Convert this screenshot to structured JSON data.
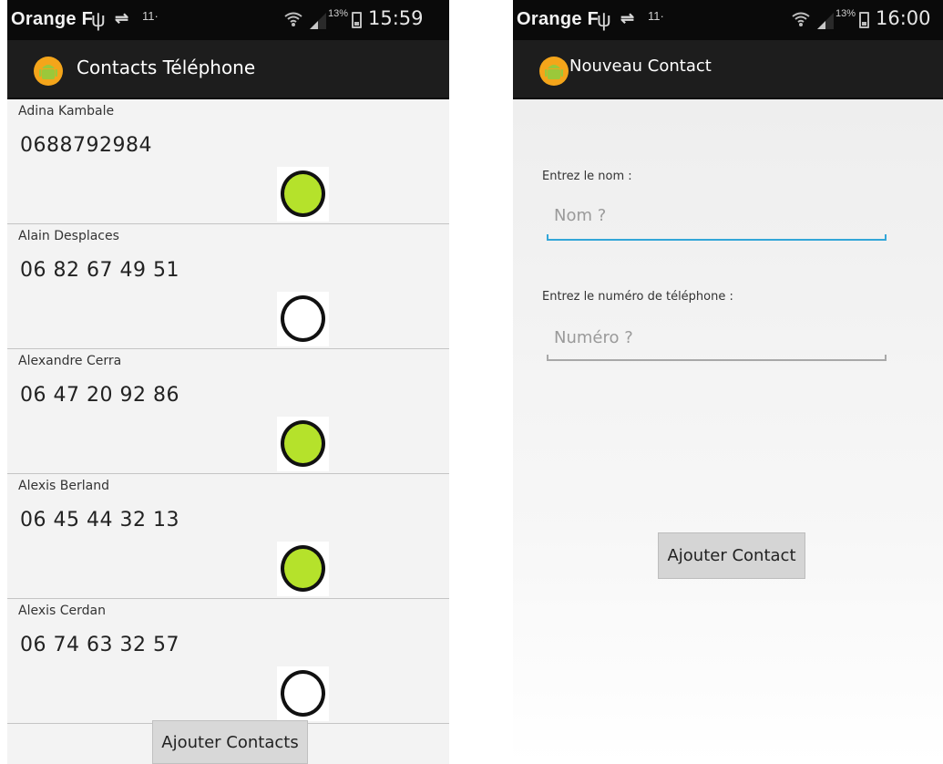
{
  "colors": {
    "active_green": "#b5e22b",
    "inactive_white": "#ffffff",
    "action_bar": "#1d1d1d",
    "focus_blue": "#33a6d8"
  },
  "icons": {
    "app": "android-icon",
    "usb": "usb-icon",
    "sync": "sync-icon",
    "wifi": "wifi-icon",
    "signal": "signal-icon",
    "battery": "battery-icon"
  },
  "left": {
    "status": {
      "carrier": "Orange F",
      "usb": "ψ",
      "sync": "⇌",
      "notif": "11·",
      "battery_pct": "13%",
      "time": "15:59"
    },
    "title": "Contacts Téléphone",
    "contacts": [
      {
        "name": "Adina Kambale",
        "phone": "0688792984",
        "active": true
      },
      {
        "name": "Alain Desplaces",
        "phone": "06 82 67 49 51",
        "active": false
      },
      {
        "name": "Alexandre Cerra",
        "phone": "06 47 20 92 86",
        "active": true
      },
      {
        "name": "Alexis Berland",
        "phone": "06 45 44 32 13",
        "active": true
      },
      {
        "name": "Alexis Cerdan",
        "phone": "06 74 63 32 57",
        "active": false
      }
    ],
    "button": "Ajouter Contacts"
  },
  "right": {
    "status": {
      "carrier": "Orange F",
      "usb": "ψ",
      "sync": "⇌",
      "notif": "11·",
      "battery_pct": "13%",
      "time": "16:00"
    },
    "title": "Nouveau Contact",
    "name_label": "Entrez le nom :",
    "name_placeholder": "Nom ?",
    "phone_label": "Entrez le numéro de téléphone :",
    "phone_placeholder": "Numéro ?",
    "button": "Ajouter Contact"
  }
}
